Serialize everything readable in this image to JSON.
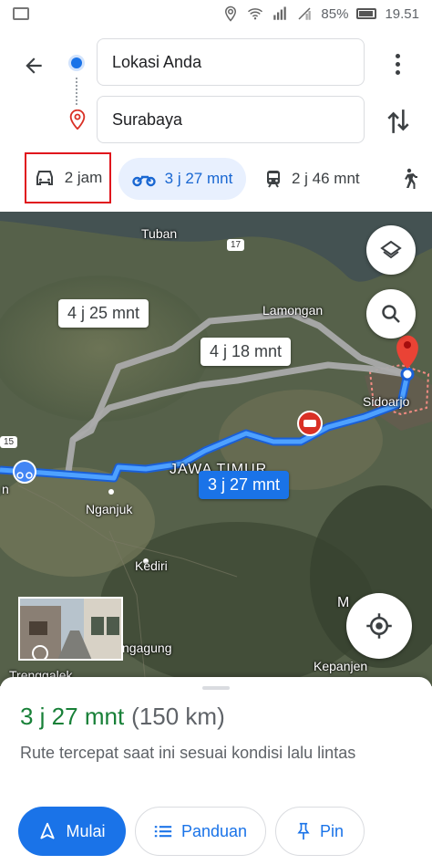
{
  "status_bar": {
    "battery": "85%",
    "time": "19.51"
  },
  "search": {
    "origin": "Lokasi Anda",
    "destination": "Surabaya"
  },
  "modes": {
    "car": "2 jam",
    "motorcycle": "3 j 27 mnt",
    "transit": "2 j 46 mnt"
  },
  "map": {
    "labels": {
      "tuban": "Tuban",
      "lamongan": "Lamongan",
      "sidoarjo": "Sidoarjo",
      "nganjuk": "Nganjuk",
      "kediri": "Kediri",
      "jawa_timur": "JAWA TIMUR",
      "kepanjen": "Kepanjen",
      "trenggalek": "Trenggalek",
      "tulungagung_partial": "ngagung",
      "malang_partial": "M",
      "edge_left": "n"
    },
    "road_badges": {
      "r17": "17",
      "r15": "15"
    },
    "routes": {
      "alt1": "4 j 25 mnt",
      "alt2": "4 j 18 mnt",
      "main": "3 j 27 mnt"
    },
    "colors": {
      "main_route": "#4285f4",
      "alt_route": "#bdbdbd",
      "destination_pin": "#ea4335"
    }
  },
  "sheet": {
    "duration": "3 j 27 mnt",
    "distance": "(150 km)",
    "description": "Rute tercepat saat ini sesuai kondisi lalu lintas",
    "buttons": {
      "start": "Mulai",
      "steps": "Panduan",
      "pin": "Pin"
    }
  }
}
